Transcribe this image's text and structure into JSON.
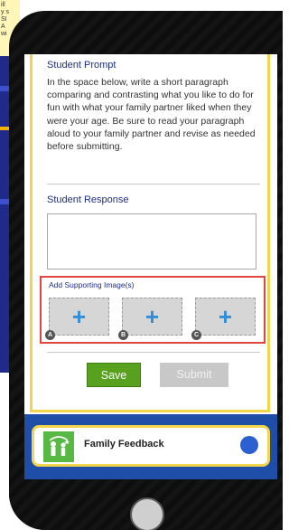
{
  "background": {
    "note_lines": [
      "ill",
      "y s",
      "SI",
      "A",
      "wi"
    ]
  },
  "prompt": {
    "title": "Student Prompt",
    "text": "In the space below, write a short paragraph comparing and contrasting what you like to do for fun with what your family partner liked when they were your age. Be sure to read your paragraph aloud to your family partner and revise as needed before submitting."
  },
  "response": {
    "title": "Student Response",
    "value": ""
  },
  "images": {
    "label": "Add Supporting Image(s)",
    "slots": [
      {
        "tag": "A",
        "plus": "+"
      },
      {
        "tag": "B",
        "plus": "+"
      },
      {
        "tag": "C",
        "plus": "+"
      }
    ]
  },
  "buttons": {
    "save": "Save",
    "submit": "Submit"
  },
  "feedback": {
    "label": "Family Feedback",
    "icon": "family-icon"
  },
  "colors": {
    "accent_yellow": "#f3d54b",
    "title_blue": "#1d2d87",
    "save_green": "#57a11f",
    "highlight_red": "#e0453e"
  }
}
